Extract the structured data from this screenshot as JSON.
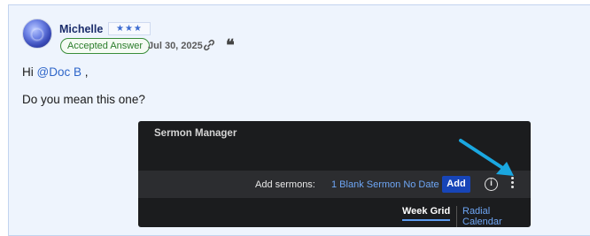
{
  "post": {
    "author": "Michelle",
    "rank": "★★★",
    "badge": "Accepted Answer",
    "date": "Jul 30, 2025",
    "greeting_prefix": "Hi ",
    "mention": "@Doc B",
    "greeting_suffix": " ,",
    "body": "Do you mean this one?"
  },
  "screenshot": {
    "title": "Sermon Manager",
    "add_label": "Add sermons:",
    "blank_link": "1 Blank Sermon No Date",
    "add_button": "Add",
    "info_symbol": "i",
    "tabs": [
      "Week Grid",
      "Radial Calendar"
    ],
    "arrow_color": "#1aa7e0"
  },
  "icons": {
    "link": "link-icon",
    "quote": "quote-icon",
    "info": "info-icon",
    "kebab": "kebab-menu-icon"
  }
}
